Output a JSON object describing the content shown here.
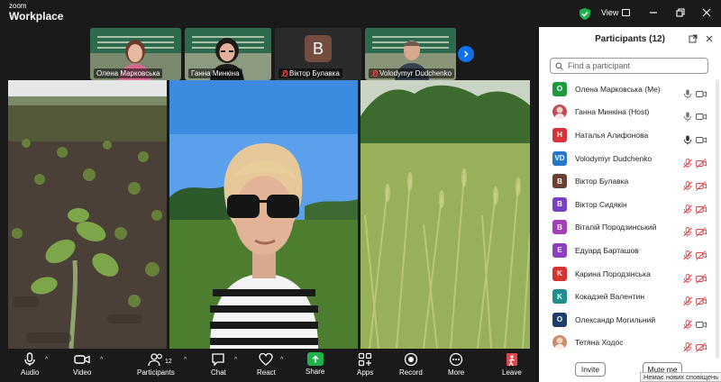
{
  "app": {
    "brand_small": "zoom",
    "brand_large": "Workplace",
    "view_label": "View"
  },
  "thumbnails": [
    {
      "name": "Олена Марковська",
      "muted": false,
      "avatar_letter": ""
    },
    {
      "name": "Ганна Минкіна",
      "muted": false,
      "avatar_letter": ""
    },
    {
      "name": "Віктор Булавка",
      "muted": true,
      "avatar_letter": "B"
    },
    {
      "name": "Volodymyr Dudchenko",
      "muted": true,
      "avatar_letter": ""
    }
  ],
  "panel": {
    "title": "Participants (12)",
    "search_placeholder": "Find a participant",
    "participants": [
      {
        "initials": "O",
        "color": "#1d9a3e",
        "name": "Олена Марковська (Me)",
        "mic": "on",
        "cam": "on"
      },
      {
        "initials": "",
        "color": "#c14b5a",
        "name": "Ганна Минкіна (Host)",
        "mic": "on",
        "cam": "on"
      },
      {
        "initials": "H",
        "color": "#d8323a",
        "name": "Наталья Алифонова",
        "mic": "on-dark",
        "cam": "on"
      },
      {
        "initials": "VD",
        "color": "#2777c9",
        "name": "Volodymyr Dudchenko",
        "mic": "off",
        "cam": "off"
      },
      {
        "initials": "B",
        "color": "#6b3f31",
        "name": "Віктор Булавка",
        "mic": "off",
        "cam": "off"
      },
      {
        "initials": "B",
        "color": "#7a3fc7",
        "name": "Віктор Сидякін",
        "mic": "off",
        "cam": "off"
      },
      {
        "initials": "B",
        "color": "#a53fb8",
        "name": "Віталій Породзинський",
        "mic": "off",
        "cam": "off"
      },
      {
        "initials": "E",
        "color": "#8c3fc0",
        "name": "Едуард Барташов",
        "mic": "off",
        "cam": "off"
      },
      {
        "initials": "K",
        "color": "#d63230",
        "name": "Карина Породзінська",
        "mic": "off",
        "cam": "off"
      },
      {
        "initials": "K",
        "color": "#1f8f8f",
        "name": "Кокадзей Валентин",
        "mic": "off",
        "cam": "off"
      },
      {
        "initials": "O",
        "color": "#1f3f6b",
        "name": "Олександр Могильний",
        "mic": "off",
        "cam": "on"
      },
      {
        "initials": "",
        "color": "#c98c6a",
        "name": "Тетяна Ходос",
        "mic": "off",
        "cam": "off"
      }
    ],
    "invite_label": "Invite",
    "mute_label": "Mute me",
    "tooltip": "Немає нових сповіщень"
  },
  "toolbar": {
    "audio": "Audio",
    "video": "Video",
    "participants": "Participants",
    "participants_count": "12",
    "chat": "Chat",
    "react": "React",
    "share": "Share",
    "apps": "Apps",
    "record": "Record",
    "more": "More",
    "leave": "Leave"
  }
}
